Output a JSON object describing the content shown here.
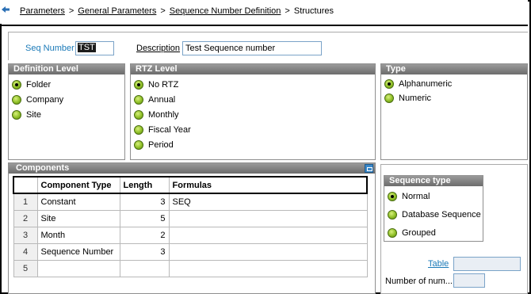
{
  "breadcrumb": {
    "items": [
      "Parameters",
      "General Parameters",
      "Sequence Number Definition",
      "Structures"
    ],
    "separator": ">"
  },
  "header": {
    "seq_number_label": "Seq Number",
    "seq_number_value": "TST",
    "description_label": "Description",
    "description_value": "Test Sequence number"
  },
  "definition_level": {
    "title": "Definition Level",
    "options": [
      "Folder",
      "Company",
      "Site"
    ],
    "selected": "Folder"
  },
  "rtz_level": {
    "title": "RTZ Level",
    "options": [
      "No RTZ",
      "Annual",
      "Monthly",
      "Fiscal Year",
      "Period"
    ],
    "selected": "No RTZ"
  },
  "type": {
    "title": "Type",
    "options": [
      "Alphanumeric",
      "Numeric"
    ],
    "selected": "Alphanumeric"
  },
  "components": {
    "title": "Components",
    "columns": [
      "Component Type",
      "Length",
      "Formulas"
    ],
    "rows": [
      {
        "num": "1",
        "type": "Constant",
        "length": "3",
        "formula": "SEQ"
      },
      {
        "num": "2",
        "type": "Site",
        "length": "5",
        "formula": ""
      },
      {
        "num": "3",
        "type": "Month",
        "length": "2",
        "formula": ""
      },
      {
        "num": "4",
        "type": "Sequence Number",
        "length": "3",
        "formula": ""
      },
      {
        "num": "5",
        "type": "",
        "length": "",
        "formula": ""
      }
    ]
  },
  "sequence_type": {
    "title": "Sequence type",
    "options": [
      "Normal",
      "Database Sequence",
      "Grouped"
    ],
    "selected": "Normal"
  },
  "extra": {
    "table_label": "Table",
    "number_label": "Number of num..."
  },
  "colors": {
    "link": "#1b7ab8",
    "group_header": "#7a7a7a",
    "radio": "#8fbf27"
  }
}
